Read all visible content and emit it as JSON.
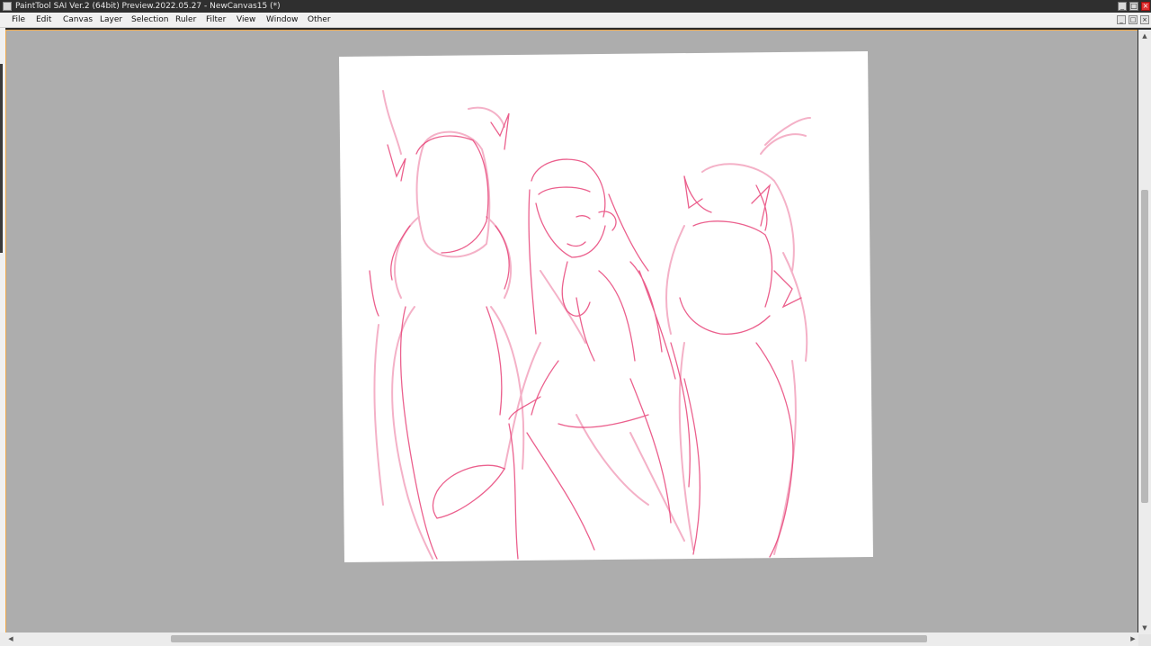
{
  "window": {
    "title": "PaintTool SAI Ver.2 (64bit) Preview.2022.05.27 - NewCanvas15 (*)",
    "controls": [
      "_",
      "□",
      "×"
    ]
  },
  "menu": {
    "items": [
      "File",
      "Edit",
      "Canvas",
      "Layer",
      "Selection",
      "Ruler",
      "Filter",
      "View",
      "Window",
      "Other"
    ],
    "mdi_controls": [
      "_",
      "□",
      "×"
    ]
  },
  "scrollbars": {
    "up": "▲",
    "down": "▼",
    "left": "◀",
    "right": "▶"
  },
  "colors": {
    "sketch": "#e8457a",
    "sketch_light": "#f3a9c2",
    "workspace": "#adadad",
    "accent": "#f0a848"
  }
}
